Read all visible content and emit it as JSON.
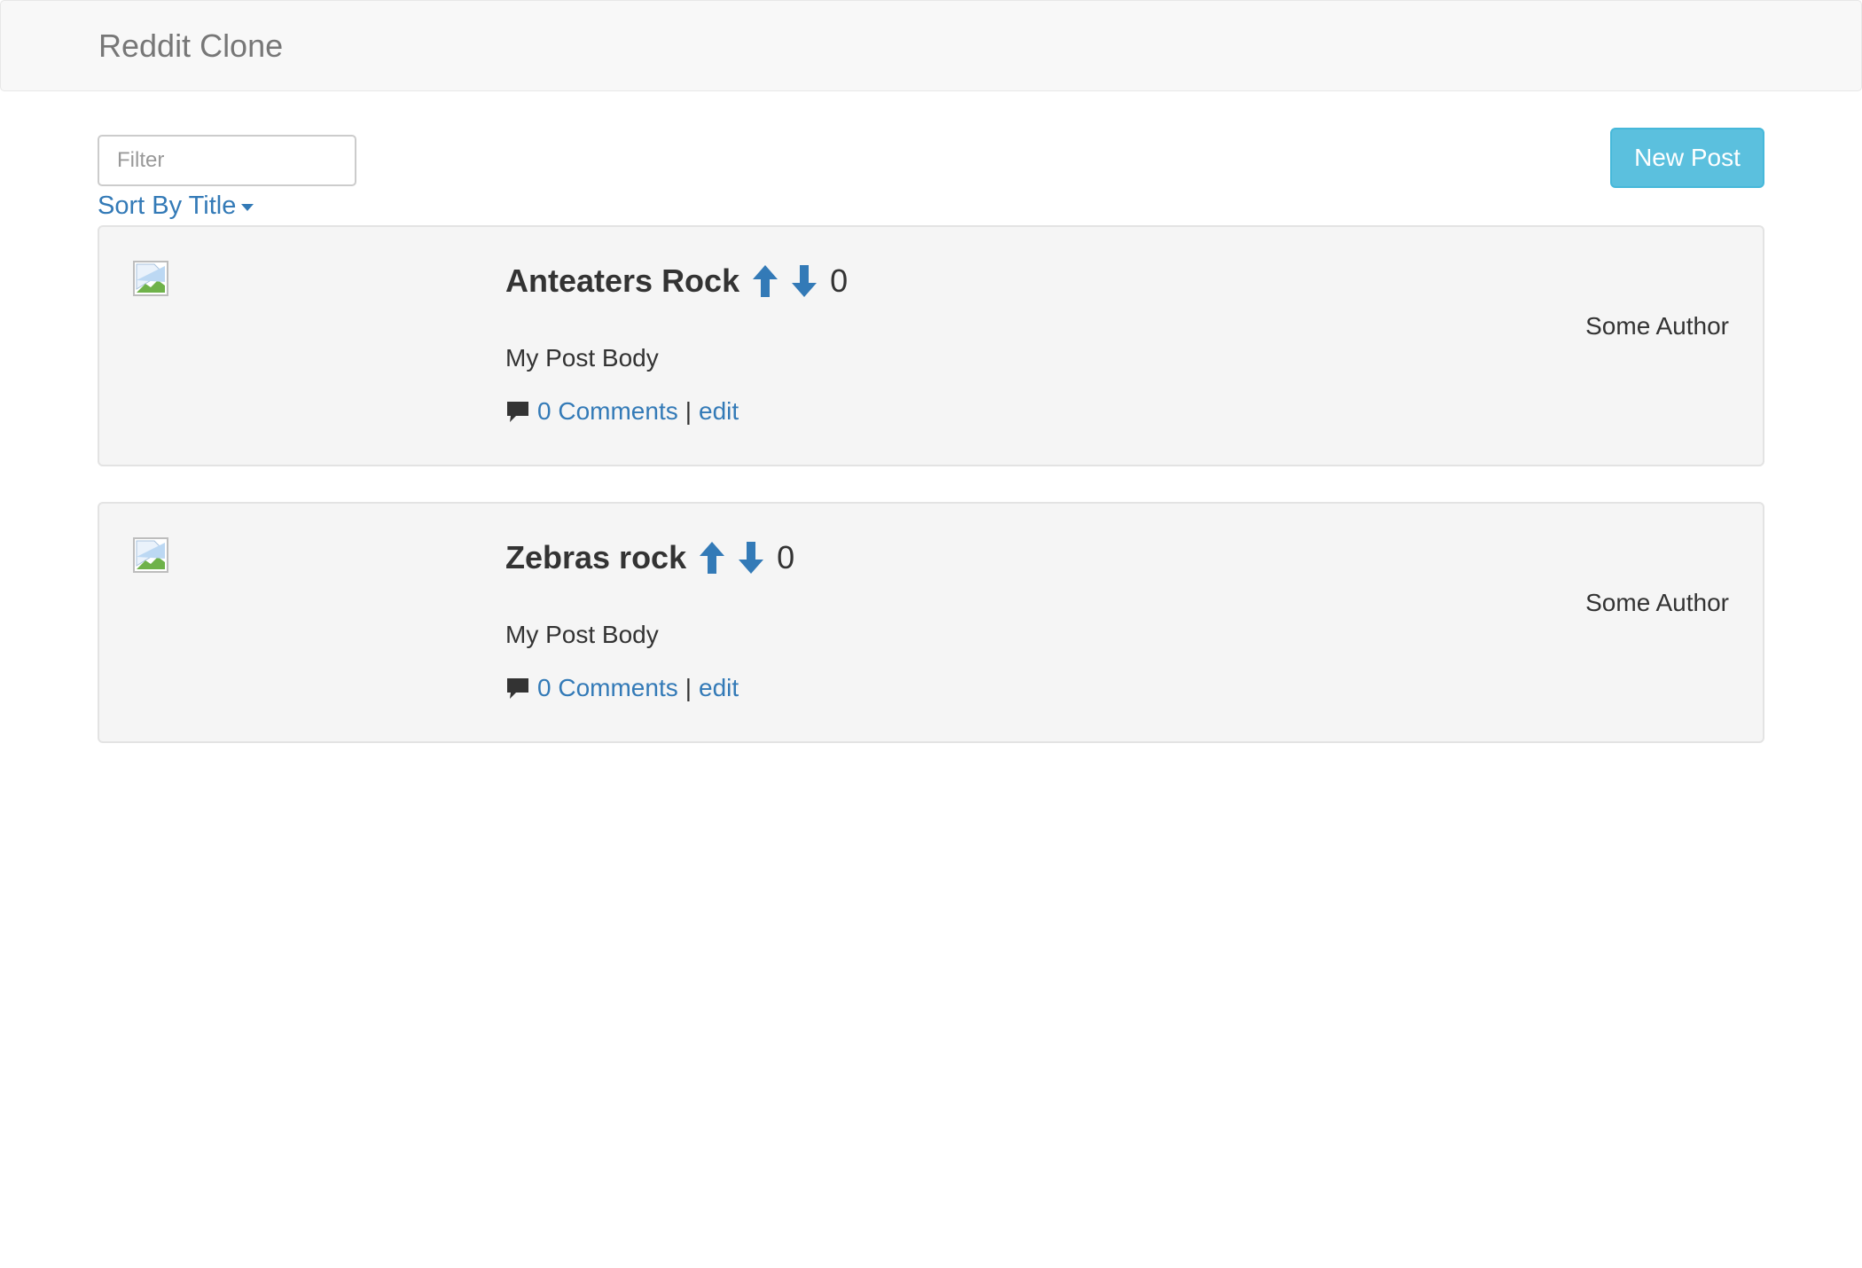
{
  "navbar": {
    "brand": "Reddit Clone"
  },
  "toolbar": {
    "filter_placeholder": "Filter",
    "sort_label": "Sort By Title",
    "new_post_label": "New Post"
  },
  "colors": {
    "link": "#337ab7",
    "info_button": "#5bc0de",
    "card_background": "#f5f5f5"
  },
  "posts": [
    {
      "title": "Anteaters Rock",
      "votes": "0",
      "author": "Some Author",
      "body": "My Post Body",
      "comments_label": "0 Comments",
      "separator": "|",
      "edit_label": "edit"
    },
    {
      "title": "Zebras rock",
      "votes": "0",
      "author": "Some Author",
      "body": "My Post Body",
      "comments_label": "0 Comments",
      "separator": "|",
      "edit_label": "edit"
    }
  ],
  "icons": {
    "upvote": "arrow-up-icon",
    "downvote": "arrow-down-icon",
    "comment": "comment-icon",
    "thumbnail": "broken-image-icon",
    "sort_caret": "caret-down-icon"
  }
}
